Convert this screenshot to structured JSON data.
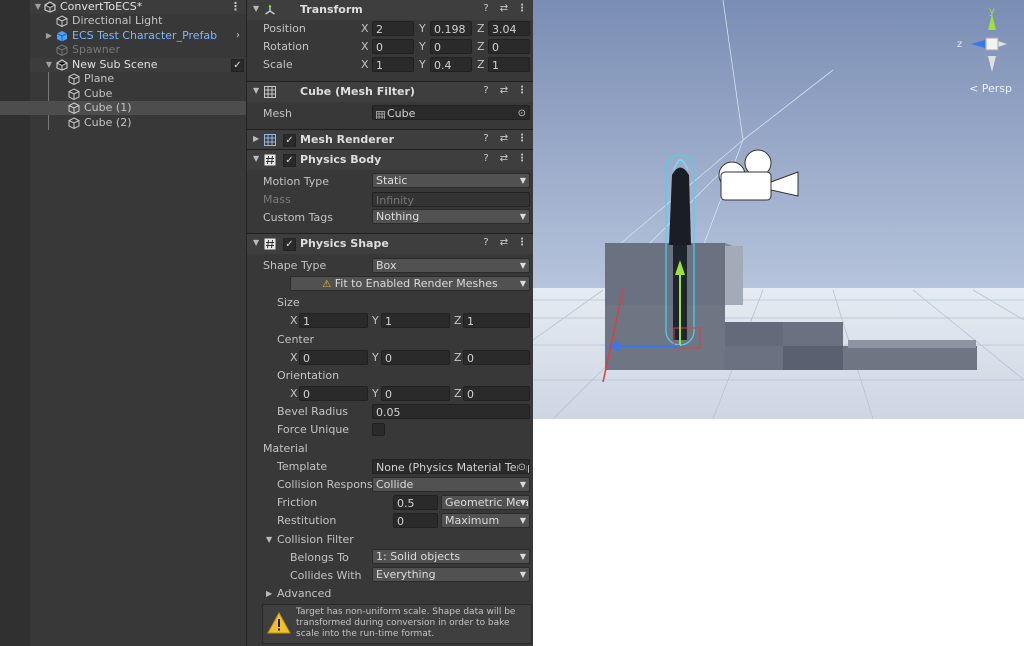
{
  "hierarchy": {
    "items": [
      {
        "label": "ConvertToECS*",
        "kind": "scene"
      },
      {
        "label": "Directional Light",
        "kind": "object"
      },
      {
        "label": "ECS Test Character_Prefab",
        "kind": "prefab"
      },
      {
        "label": "Spawner",
        "kind": "disabled"
      },
      {
        "label": "New Sub Scene",
        "kind": "subscene"
      },
      {
        "label": "Plane",
        "kind": "object"
      },
      {
        "label": "Cube",
        "kind": "object"
      },
      {
        "label": "Cube (1)",
        "kind": "object",
        "selected": true
      },
      {
        "label": "Cube (2)",
        "kind": "object"
      }
    ]
  },
  "inspector": {
    "transform": {
      "title": "Transform",
      "position": {
        "label": "Position",
        "x": "2",
        "y": "0.198",
        "z": "3.04"
      },
      "rotation": {
        "label": "Rotation",
        "x": "0",
        "y": "0",
        "z": "0"
      },
      "scale": {
        "label": "Scale",
        "x": "1",
        "y": "0.4",
        "z": "1"
      }
    },
    "mesh_filter": {
      "title": "Cube (Mesh Filter)",
      "mesh_label": "Mesh",
      "mesh_value": "Cube"
    },
    "mesh_renderer": {
      "title": "Mesh Renderer"
    },
    "physics_body": {
      "title": "Physics Body",
      "motion_type_label": "Motion Type",
      "motion_type_value": "Static",
      "mass_label": "Mass",
      "mass_value": "Infinity",
      "custom_tags_label": "Custom Tags",
      "custom_tags_value": "Nothing"
    },
    "physics_shape": {
      "title": "Physics Shape",
      "shape_type_label": "Shape Type",
      "shape_type_value": "Box",
      "fit_button": "Fit to Enabled Render Meshes",
      "size_label": "Size",
      "size": {
        "x": "1",
        "y": "1",
        "z": "1"
      },
      "center_label": "Center",
      "center": {
        "x": "0",
        "y": "0",
        "z": "0"
      },
      "orientation_label": "Orientation",
      "orientation": {
        "x": "0",
        "y": "0",
        "z": "0"
      },
      "bevel_radius_label": "Bevel Radius",
      "bevel_radius_value": "0.05",
      "force_unique_label": "Force Unique",
      "material_label": "Material",
      "template_label": "Template",
      "template_value": "None (Physics Material Template)",
      "collision_response_label": "Collision Response",
      "collision_response_value": "Collide",
      "friction_label": "Friction",
      "friction_value": "0.5",
      "friction_combine": "Geometric Mean",
      "restitution_label": "Restitution",
      "restitution_value": "0",
      "restitution_combine": "Maximum",
      "collision_filter_label": "Collision Filter",
      "belongs_to_label": "Belongs To",
      "belongs_to_value": "1: Solid objects",
      "collides_with_label": "Collides With",
      "collides_with_value": "Everything",
      "advanced_label": "Advanced",
      "warning": "Target has non-uniform scale. Shape data will be transformed during conversion in order to bake scale into the run-time format."
    },
    "axis": {
      "x": "X",
      "y": "Y",
      "z": "Z"
    }
  },
  "scene": {
    "projection_label": "< Persp",
    "gizmo_y": "y",
    "gizmo_z": "z",
    "colors": {
      "sky": "#7e93b9",
      "ground": "#d8dde6",
      "axis_x": "#e23c3c",
      "axis_y": "#9be33c",
      "axis_z": "#3a77e8"
    }
  }
}
